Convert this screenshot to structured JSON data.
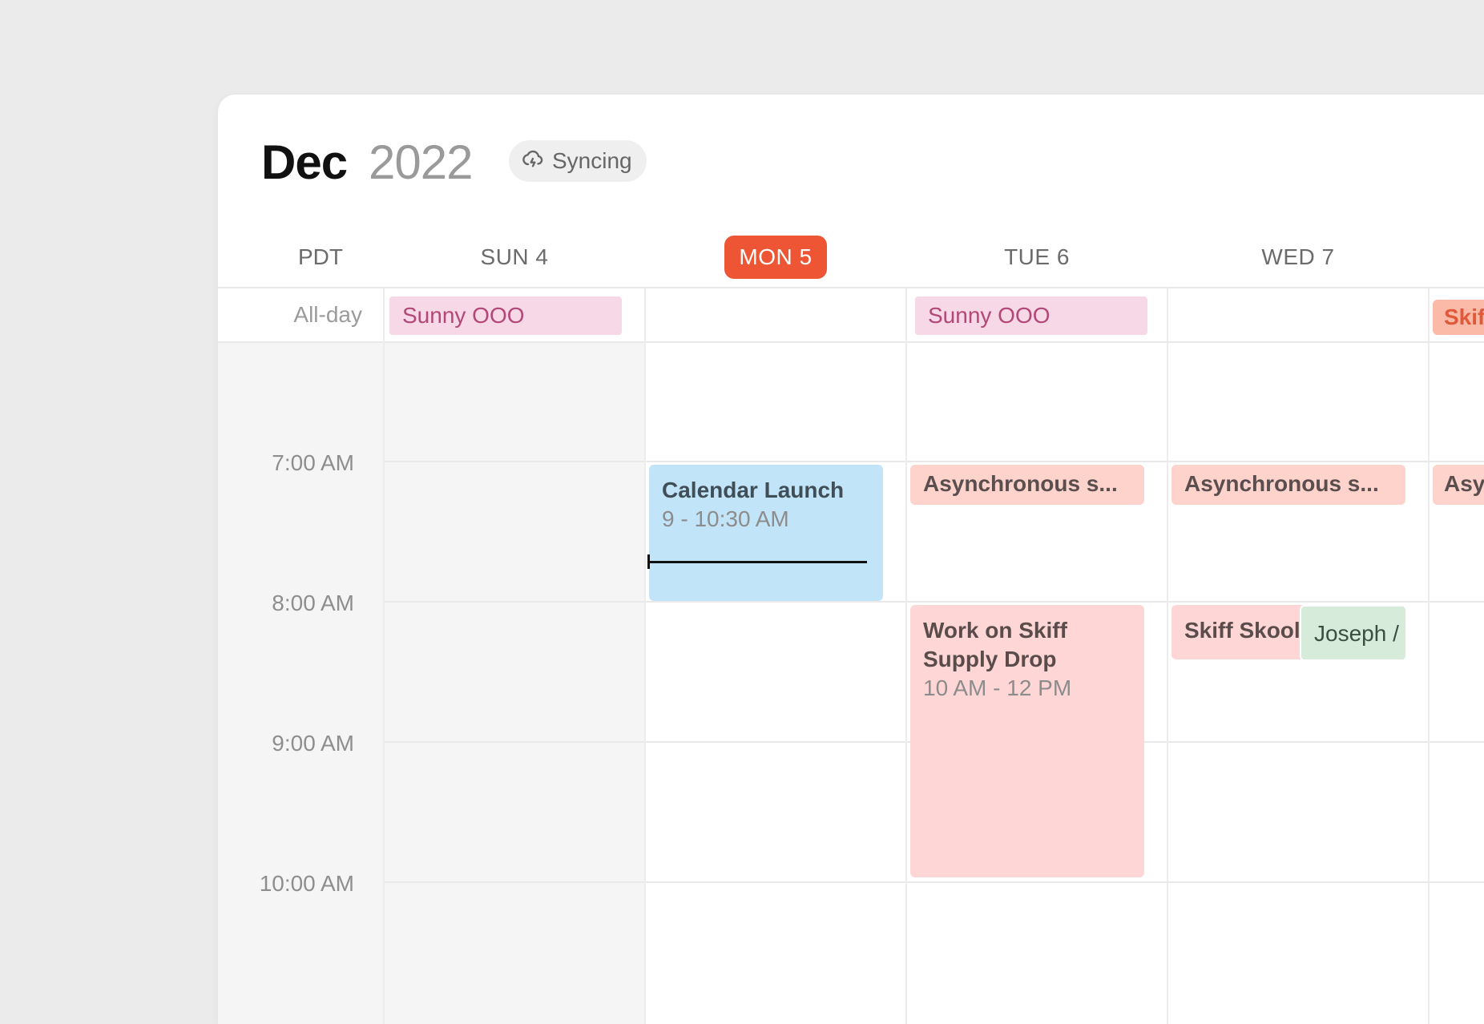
{
  "header": {
    "month": "Dec",
    "year": "2022",
    "sync_status": "Syncing",
    "sync_icon": "cloud-sync-icon"
  },
  "timezone": "PDT",
  "days": [
    {
      "label": "SUN 4",
      "today": false
    },
    {
      "label": "MON 5",
      "today": true
    },
    {
      "label": "TUE 6",
      "today": false
    },
    {
      "label": "WED 7",
      "today": false
    }
  ],
  "allday": {
    "label": "All-day",
    "events": [
      {
        "title": "Sunny OOO"
      },
      {
        "title": "Sunny OOO"
      },
      {
        "title": "Skif"
      }
    ]
  },
  "times": [
    "7:00 AM",
    "8:00 AM",
    "9:00 AM",
    "10:00 AM"
  ],
  "events": {
    "calendar_launch": {
      "title": "Calendar Launch",
      "time": "9 - 10:30 AM"
    },
    "async_tue": {
      "title": "Asynchronous s..."
    },
    "async_wed": {
      "title": "Asynchronous s..."
    },
    "async_thu": {
      "title": "Asy"
    },
    "work_skiff": {
      "title_line1": "Work on Skiff",
      "title_line2": "Supply Drop",
      "time": "10 AM - 12 PM"
    },
    "skiff_skool": {
      "title": "Skiff Skool"
    },
    "joseph": {
      "title": "Joseph /"
    }
  },
  "colors": {
    "today": "#ee5535",
    "event_blue": "#c2e4f8",
    "event_pink": "#ffd6d6",
    "event_salmon": "#fed3cc",
    "event_green": "#d7ebdb",
    "allday_pink": "#f7d8e6"
  }
}
